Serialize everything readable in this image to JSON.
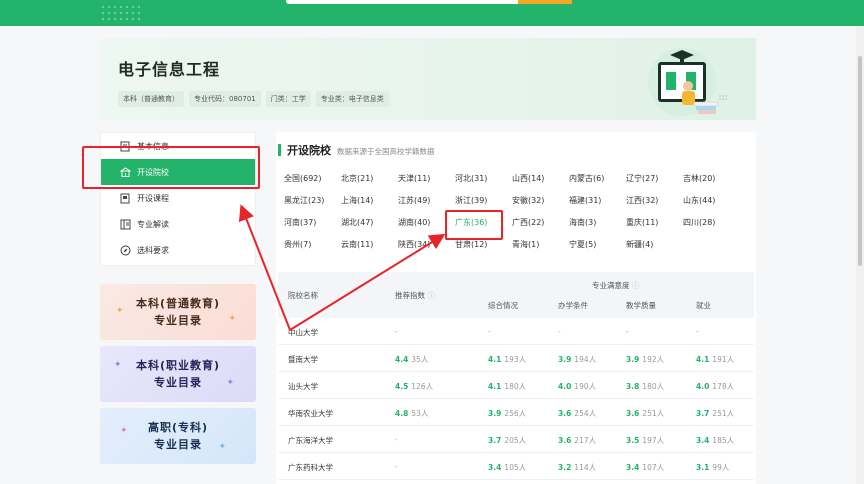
{
  "header": {
    "title": "电子信息工程",
    "tags": [
      "本科（普通教育）",
      "专业代码：080701",
      "门类：工学",
      "专业类：电子信息类"
    ]
  },
  "nav": {
    "items": [
      {
        "label": "基本信息",
        "icon": "info-doc-icon"
      },
      {
        "label": "开设院校",
        "icon": "school-icon"
      },
      {
        "label": "开设课程",
        "icon": "course-icon"
      },
      {
        "label": "专业解读",
        "icon": "book-icon"
      },
      {
        "label": "选科要求",
        "icon": "compass-icon"
      }
    ],
    "active_index": 1
  },
  "promos": [
    {
      "line1": "本科(普通教育)",
      "line2": "专业目录"
    },
    {
      "line1": "本科(职业教育)",
      "line2": "专业目录"
    },
    {
      "line1": "高职(专科)",
      "line2": "专业目录"
    }
  ],
  "section": {
    "title": "开设院校",
    "subtitle": "数据来源于全国高校学籍数据"
  },
  "regions": [
    "全国(692)",
    "北京(21)",
    "天津(11)",
    "河北(31)",
    "山西(14)",
    "内蒙古(6)",
    "辽宁(27)",
    "吉林(20)",
    "黑龙江(23)",
    "上海(14)",
    "江苏(49)",
    "浙江(39)",
    "安徽(32)",
    "福建(31)",
    "江西(32)",
    "山东(44)",
    "河南(37)",
    "湖北(47)",
    "湖南(40)",
    "广东(36)",
    "广西(22)",
    "海南(3)",
    "重庆(11)",
    "四川(28)",
    "贵州(7)",
    "云南(11)",
    "陕西(34)",
    "甘肃(12)",
    "青海(1)",
    "宁夏(5)",
    "新疆(4)"
  ],
  "selected_region_index": 19,
  "table": {
    "headers": {
      "name": "院校名称",
      "index": "推荐指数",
      "group": "专业满意度",
      "overall": "综合情况",
      "conditions": "办学条件",
      "quality": "教学质量",
      "employment": "就业"
    },
    "rows": [
      {
        "name": "中山大学",
        "index": "-",
        "index_n": "",
        "overall": "-",
        "overall_n": "",
        "conditions": "-",
        "conditions_n": "",
        "quality": "-",
        "quality_n": "",
        "employment": "-",
        "employment_n": ""
      },
      {
        "name": "暨南大学",
        "index": "4.4",
        "index_n": "35人",
        "overall": "4.1",
        "overall_n": "193人",
        "conditions": "3.9",
        "conditions_n": "194人",
        "quality": "3.9",
        "quality_n": "192人",
        "employment": "4.1",
        "employment_n": "191人"
      },
      {
        "name": "汕头大学",
        "index": "4.5",
        "index_n": "126人",
        "overall": "4.1",
        "overall_n": "180人",
        "conditions": "4.0",
        "conditions_n": "190人",
        "quality": "3.8",
        "quality_n": "180人",
        "employment": "4.0",
        "employment_n": "178人"
      },
      {
        "name": "华南农业大学",
        "index": "4.8",
        "index_n": "53人",
        "overall": "3.9",
        "overall_n": "256人",
        "conditions": "3.6",
        "conditions_n": "254人",
        "quality": "3.6",
        "quality_n": "251人",
        "employment": "3.7",
        "employment_n": "251人"
      },
      {
        "name": "广东海洋大学",
        "index": "-",
        "index_n": "",
        "overall": "3.7",
        "overall_n": "205人",
        "conditions": "3.6",
        "conditions_n": "217人",
        "quality": "3.5",
        "quality_n": "197人",
        "employment": "3.4",
        "employment_n": "185人"
      },
      {
        "name": "广东药科大学",
        "index": "-",
        "index_n": "",
        "overall": "3.4",
        "overall_n": "105人",
        "conditions": "3.2",
        "conditions_n": "114人",
        "quality": "3.4",
        "quality_n": "107人",
        "employment": "3.1",
        "employment_n": "99人"
      }
    ]
  },
  "colors": {
    "accent": "#23b36a",
    "annotation": "#e8232a"
  }
}
